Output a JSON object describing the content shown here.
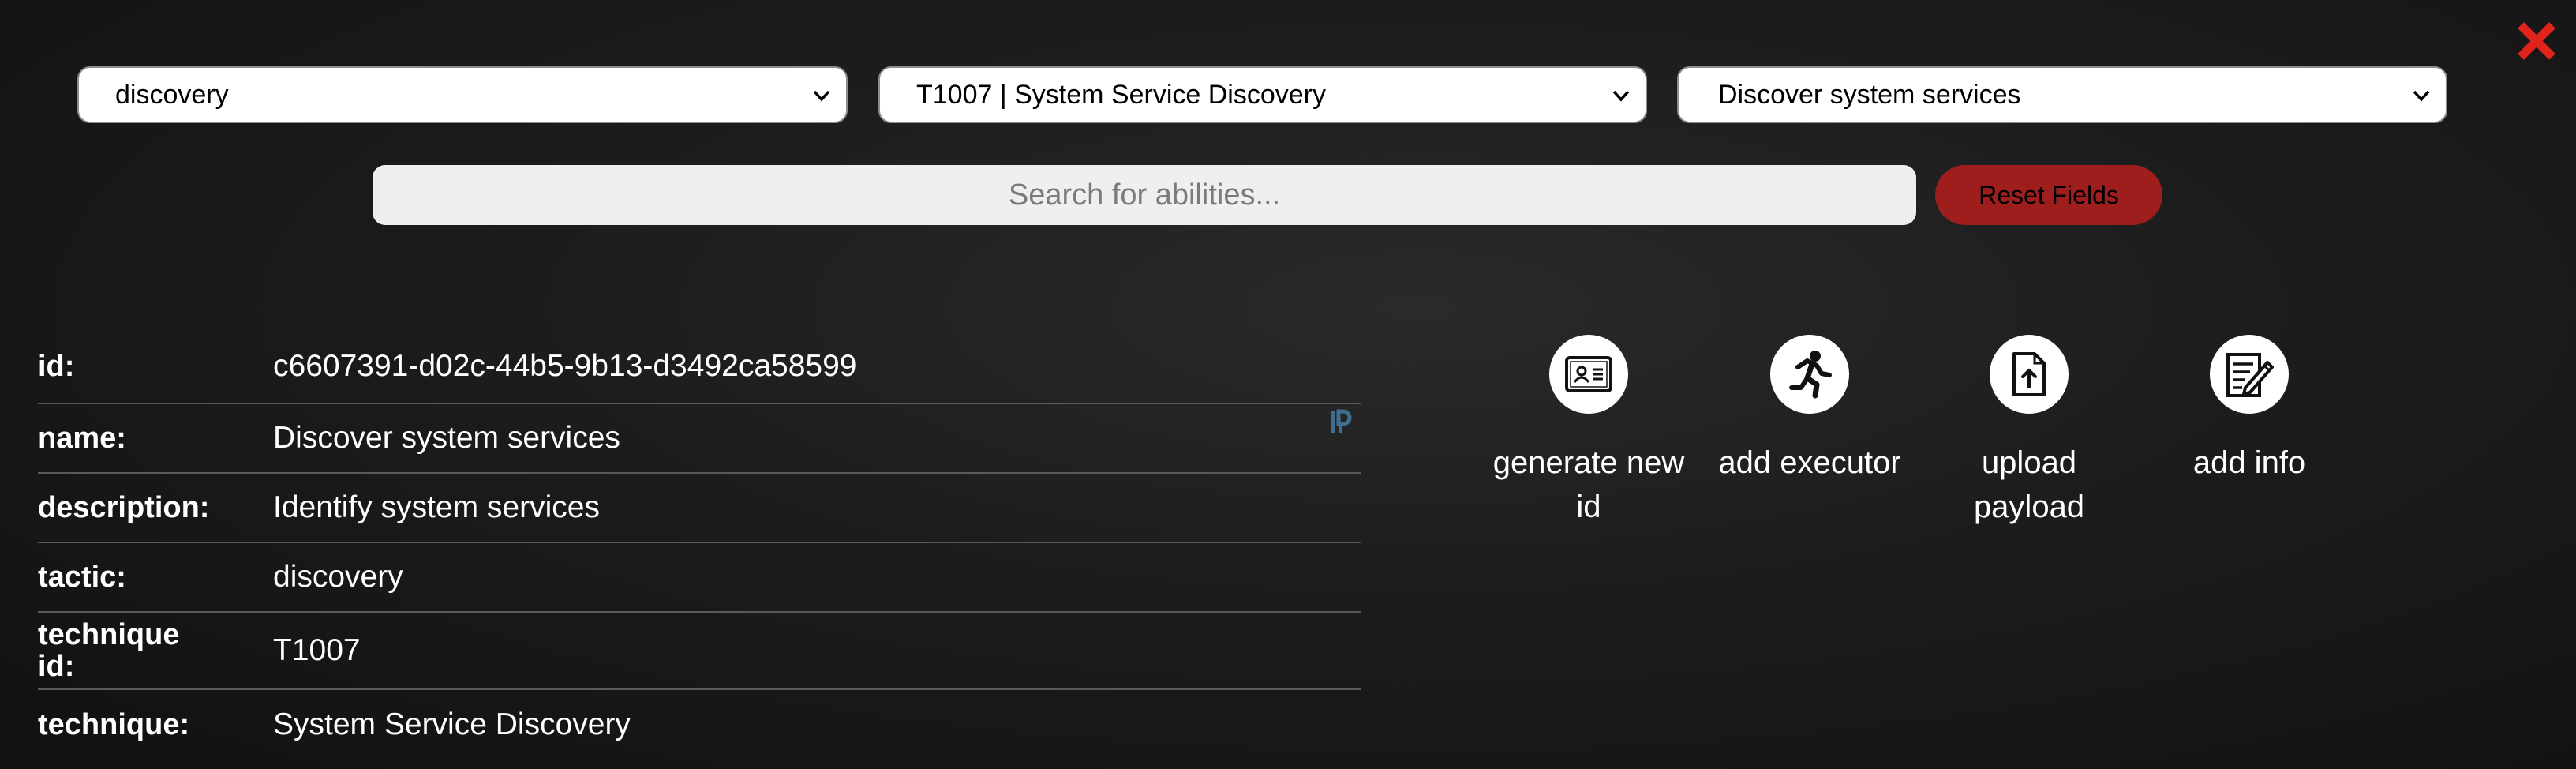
{
  "close": {
    "icon": "close-icon",
    "color": "#e0241b"
  },
  "selects": {
    "tactic": "discovery",
    "technique": "T1007 | System Service Discovery",
    "ability": "Discover system services"
  },
  "search": {
    "placeholder": "Search for abilities...",
    "value": ""
  },
  "reset_label": "Reset Fields",
  "reset_color": "#9e1e1e",
  "details": {
    "id_label": "id:",
    "id_value": "c6607391-d02c-44b5-9b13-d3492ca58599",
    "name_label": "name:",
    "name_value": "Discover system services",
    "description_label": "description:",
    "description_value": "Identify system services",
    "tactic_label": "tactic:",
    "tactic_value": "discovery",
    "technique_id_label_1": "technique",
    "technique_id_label_2": "id:",
    "technique_id_value": "T1007",
    "technique_label": "technique:",
    "technique_value": "System Service Discovery"
  },
  "actions": [
    {
      "label": "generate new id",
      "icon": "id-card-icon"
    },
    {
      "label": "add executor",
      "icon": "running-person-icon"
    },
    {
      "label": "upload payload",
      "icon": "file-upload-icon"
    },
    {
      "label": "add info",
      "icon": "edit-notes-icon"
    }
  ]
}
